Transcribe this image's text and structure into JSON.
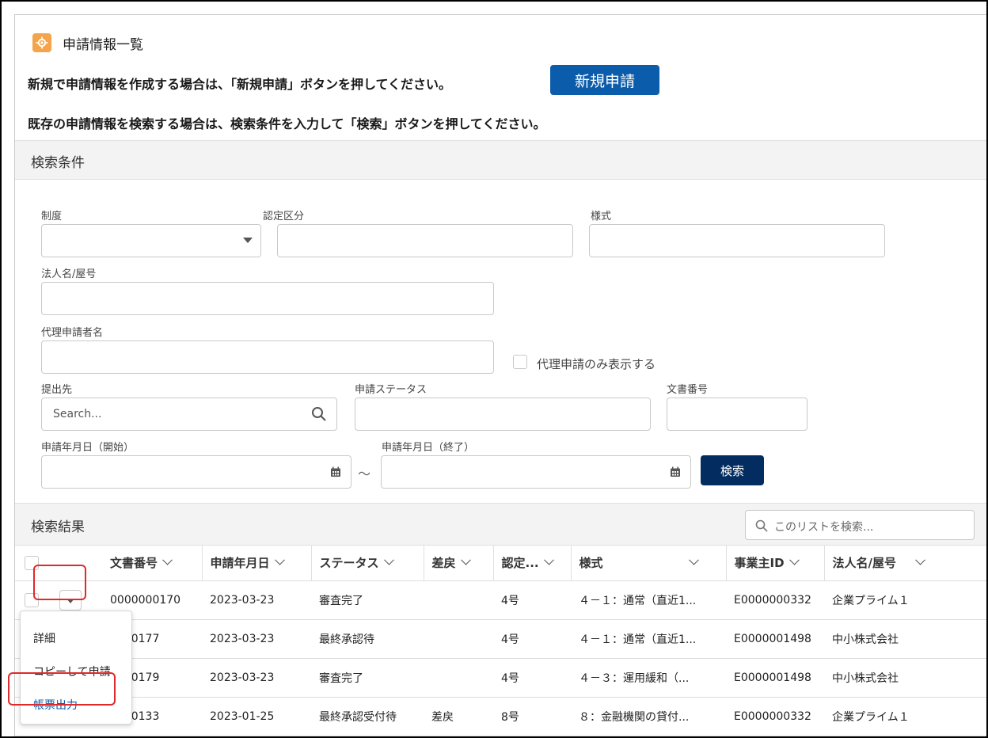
{
  "header": {
    "title": "申請情報一覧",
    "icon": "gear-icon"
  },
  "instructions": {
    "line1": "新規で申請情報を作成する場合は、「新規申請」ボタンを押してください。",
    "line2": "既存の申請情報を検索する場合は、検索条件を入力して「検索」ボタンを押してください。",
    "new_button": "新規申請"
  },
  "search": {
    "section_title": "検索条件",
    "labels": {
      "system": "制度",
      "certification": "認定区分",
      "format": "様式",
      "corporation": "法人名/屋号",
      "proxy": "代理申請者名",
      "proxy_only": "代理申請のみ表示する",
      "destination": "提出先",
      "status": "申請ステータス",
      "doc_number": "文書番号",
      "date_start": "申請年月日（開始）",
      "date_end": "申請年月日（終了）"
    },
    "destination_placeholder": "Search...",
    "tilde": "～",
    "search_button": "検索"
  },
  "results": {
    "section_title": "検索結果",
    "list_search_placeholder": "このリストを検索...",
    "columns": [
      "文書番号",
      "申請年月日",
      "ステータス",
      "差戻",
      "認定...",
      "様式",
      "事業主ID",
      "法人名/屋号"
    ],
    "rows": [
      [
        "0000000170",
        "2023-03-23",
        "審査完了",
        "",
        "4号",
        "４－１：通常（直近1...",
        "E0000000332",
        "企業プライム１"
      ],
      [
        "0000177",
        "2023-03-23",
        "最終承認待",
        "",
        "4号",
        "４－１：通常（直近1...",
        "E0000001498",
        "中小株式会社"
      ],
      [
        "0000179",
        "2023-03-23",
        "審査完了",
        "",
        "4号",
        "４－３：運用緩和（...",
        "E0000001498",
        "中小株式会社"
      ],
      [
        "0000133",
        "2023-01-25",
        "最終承認受付待",
        "差戻",
        "8号",
        "８：金融機関の貸付...",
        "E0000000332",
        "企業プライム１"
      ]
    ]
  },
  "row_menu": {
    "items": [
      "詳細",
      "コピーして申請",
      "帳票出力"
    ]
  },
  "colors": {
    "brand": "#0b5cab",
    "search_btn": "#032d60",
    "highlight": "#e0292b",
    "app_icon": "#f4a44b"
  }
}
